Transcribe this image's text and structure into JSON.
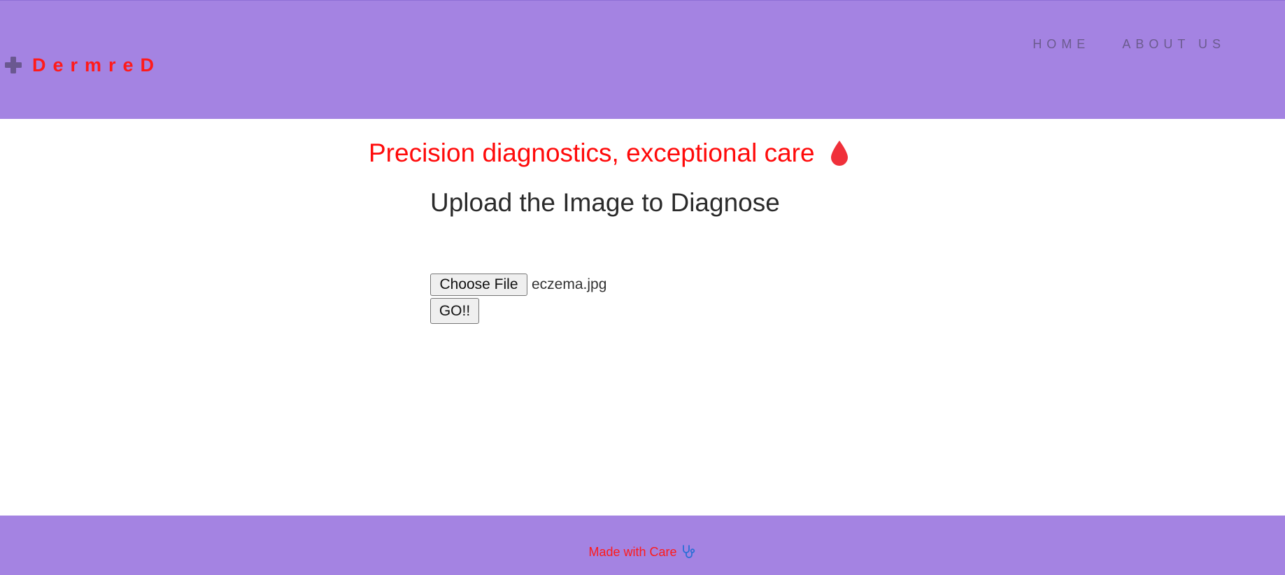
{
  "header": {
    "brand": "DermreD",
    "brand_icon": "plus-icon",
    "nav": [
      {
        "label": "HOME"
      },
      {
        "label": "ABOUT US"
      }
    ]
  },
  "main": {
    "tagline": "Precision diagnostics, exceptional care",
    "tagline_icon": "drop-icon",
    "upload_title": "Upload the Image to Diagnose",
    "choose_file_label": "Choose File",
    "file_name": "eczema.jpg",
    "go_label": "GO!!"
  },
  "footer": {
    "text": "Made with Care",
    "icon": "stethoscope-icon"
  },
  "colors": {
    "header_bg": "#a483e2",
    "brand": "#ff1a1a",
    "tagline": "#ff0a0a",
    "nav": "#6b5b8e"
  }
}
